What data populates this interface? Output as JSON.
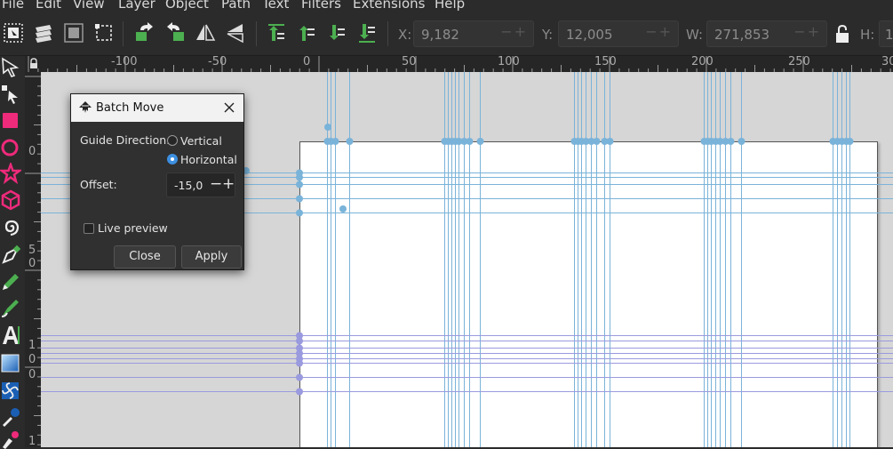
{
  "menu": [
    "File",
    "Edit",
    "View",
    "Layer",
    "Object",
    "Path",
    "Text",
    "Filters",
    "Extensions",
    "Help"
  ],
  "toolbar": {
    "x_label": "X:",
    "x_value": "9,182",
    "y_label": "Y:",
    "y_value": "12,005",
    "w_label": "W:",
    "w_value": "271,853",
    "h_label": "H:",
    "h_value": "1",
    "spin_symbols": "−+"
  },
  "hruler_labels": [
    "-100",
    "-50",
    "0",
    "50",
    "100",
    "150",
    "200",
    "250",
    "30"
  ],
  "vruler_labels": [
    "0",
    "5",
    "0",
    "1",
    "0",
    "0",
    "1"
  ],
  "dialog": {
    "title": "Batch Move",
    "guide_direction_label": "Guide Direction:",
    "option_vertical": "Vertical",
    "option_horizontal": "Horizontal",
    "selected_direction": "Horizontal",
    "offset_label": "Offset:",
    "offset_value": "-15,0",
    "offset_minus": "−",
    "offset_plus": "+",
    "live_preview_label": "Live preview",
    "live_preview_checked": false,
    "close_label": "Close",
    "apply_label": "Apply"
  },
  "colors": {
    "guide": "#7ab3d9",
    "guide_purple": "#9a9adf",
    "accent": "#3d8fe0",
    "canvas": "#d6d6d6",
    "page": "#ffffff"
  },
  "icons": [
    "selector-tool-icon",
    "node-tool-icon",
    "rectangle-tool-icon",
    "ellipse-tool-icon",
    "star-tool-icon",
    "box3d-tool-icon",
    "spiral-tool-icon",
    "pen-tool-icon",
    "pencil-tool-icon",
    "calligraphy-tool-icon",
    "text-tool-icon",
    "gradient-tool-icon",
    "mesh-tool-icon",
    "dropper-tool-icon"
  ]
}
